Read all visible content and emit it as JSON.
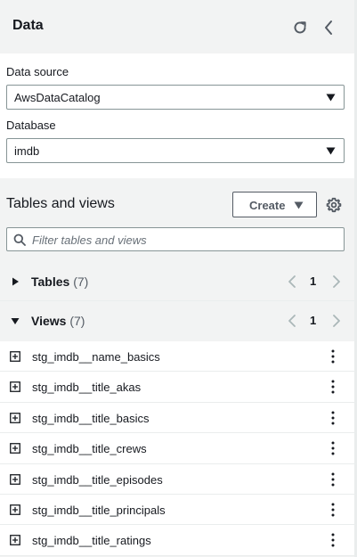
{
  "header": {
    "title": "Data",
    "refresh_icon": "refresh-icon",
    "collapse_icon": "chevron-left-icon"
  },
  "data_source": {
    "label": "Data source",
    "value": "AwsDataCatalog"
  },
  "database": {
    "label": "Database",
    "value": "imdb"
  },
  "tables_and_views": {
    "title": "Tables and views",
    "create_label": "Create",
    "settings_icon": "gear-icon",
    "filter_placeholder": "Filter tables and views",
    "filter_value": ""
  },
  "tables": {
    "name": "Tables",
    "count": "(7)",
    "page": "1",
    "expanded": false
  },
  "views": {
    "name": "Views",
    "count": "(7)",
    "page": "1",
    "expanded": true,
    "items": [
      "stg_imdb__name_basics",
      "stg_imdb__title_akas",
      "stg_imdb__title_basics",
      "stg_imdb__title_crews",
      "stg_imdb__title_episodes",
      "stg_imdb__title_principals",
      "stg_imdb__title_ratings"
    ]
  },
  "colors": {
    "text": "#16191f",
    "secondary": "#545b64",
    "border": "#879596",
    "muted_bg": "#f2f3f3",
    "divider": "#eaeded"
  }
}
